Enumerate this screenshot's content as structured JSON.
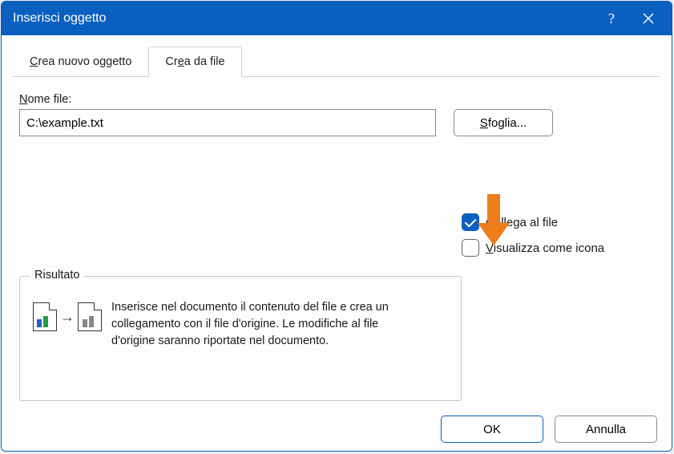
{
  "title": "Inserisci oggetto",
  "tabs": {
    "create_new": "Crea nuovo oggetto",
    "create_from_file": "Crea da file"
  },
  "file": {
    "label_pre": "N",
    "label_post": "ome file:",
    "value": "C:\\example.txt"
  },
  "browse": {
    "pre": "S",
    "post": "foglia..."
  },
  "link": {
    "pre": "C",
    "mid": "o",
    "post": "llega al file"
  },
  "as_icon": {
    "pre": "V",
    "post": "isualizza come icona"
  },
  "result": {
    "legend": "Risultato",
    "text": "Inserisce nel documento il contenuto del file e crea un collegamento con il file d'origine.  Le modifiche al file d'origine saranno riportate nel documento."
  },
  "buttons": {
    "ok": "OK",
    "cancel": "Annulla"
  }
}
